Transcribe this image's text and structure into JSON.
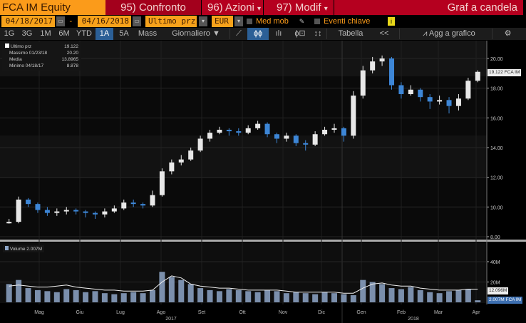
{
  "header": {
    "ticker": "FCA IM Equity",
    "compare": "95) Confronto",
    "actions": "96) Azioni",
    "modify": "97) Modif",
    "chart_type": "Graf a candela"
  },
  "controls": {
    "start_date": "04/18/2017",
    "end_date": "04/16/2018",
    "dash": "-",
    "field": "Ultimo prz",
    "currency": "EUR",
    "moving_avg": "Med mob",
    "key_events": "Eventi chiave",
    "info": "i"
  },
  "toolbar": {
    "periods": [
      "1G",
      "3G",
      "1M",
      "6M",
      "YTD",
      "1A",
      "5A",
      "Mass"
    ],
    "active_period": "1A",
    "frequency": "Giornaliero ▼",
    "table": "Tabella",
    "collapse": "<<",
    "add_to_chart": "Agg a grafico"
  },
  "legend": {
    "rows": [
      {
        "label": "Ultimo prz",
        "value": "19.122"
      },
      {
        "label": "Massimo 01/23/18",
        "value": "20.20"
      },
      {
        "label": "Media",
        "value": "13.8965"
      },
      {
        "label": "Minimo 04/18/17",
        "value": "8.878"
      }
    ]
  },
  "colors": {
    "up": "#e8e8e8",
    "down": "#3d86d6",
    "volume": "#8ea6c8",
    "ma": "#f0f0f0"
  },
  "chart_data": [
    {
      "type": "candlestick",
      "title": "FCA IM Equity",
      "ylim": [
        8,
        21
      ],
      "yticks": [
        "20.00",
        "18.00",
        "16.00",
        "14.00",
        "12.00",
        "10.00",
        "8.00"
      ],
      "last_label": "19.122 FCA IM",
      "open": [
        8.9,
        9.0,
        10.5,
        10.2,
        9.8,
        9.6,
        9.7,
        9.8,
        9.7,
        9.6,
        9.5,
        9.7,
        9.9,
        10.3,
        10.2,
        10.1,
        10.8,
        12.4,
        13.0,
        13.2,
        13.8,
        14.6,
        15.0,
        15.2,
        15.1,
        15.0,
        15.3,
        15.6,
        14.9,
        14.6,
        14.8,
        14.3,
        14.2,
        14.9,
        15.2,
        15.3,
        14.8,
        17.5,
        19.2,
        19.8,
        20.0,
        18.2,
        17.6,
        17.9,
        17.4,
        17.1,
        17.2,
        16.8,
        17.3,
        18.5
      ],
      "high": [
        9.2,
        10.7,
        10.6,
        10.3,
        10.0,
        9.9,
        10.0,
        9.9,
        9.8,
        9.7,
        9.9,
        10.1,
        10.5,
        10.5,
        10.3,
        11.1,
        12.6,
        13.2,
        13.5,
        14.0,
        14.8,
        15.2,
        15.4,
        15.3,
        15.3,
        15.5,
        15.8,
        15.7,
        15.0,
        15.0,
        14.9,
        14.5,
        15.1,
        15.4,
        15.6,
        15.4,
        17.8,
        19.5,
        20.1,
        20.2,
        20.1,
        18.4,
        18.2,
        18.0,
        17.6,
        17.5,
        17.4,
        17.6,
        18.7,
        19.2
      ],
      "low": [
        8.88,
        8.9,
        10.0,
        9.6,
        9.4,
        9.4,
        9.5,
        9.5,
        9.3,
        9.2,
        9.3,
        9.6,
        9.8,
        10.0,
        9.9,
        10.0,
        10.7,
        12.2,
        12.8,
        13.1,
        13.7,
        14.4,
        14.9,
        14.8,
        14.8,
        14.9,
        15.2,
        14.7,
        14.3,
        14.4,
        14.1,
        13.8,
        14.1,
        14.8,
        15.0,
        14.4,
        14.6,
        17.3,
        19.0,
        19.5,
        17.9,
        17.3,
        17.5,
        17.1,
        16.6,
        16.9,
        16.3,
        16.5,
        17.2,
        18.4
      ],
      "close": [
        9.0,
        10.5,
        10.2,
        9.8,
        9.6,
        9.7,
        9.8,
        9.7,
        9.6,
        9.5,
        9.7,
        9.9,
        10.3,
        10.2,
        10.1,
        10.8,
        12.4,
        13.0,
        13.2,
        13.8,
        14.6,
        15.0,
        15.2,
        15.1,
        15.0,
        15.3,
        15.6,
        14.9,
        14.6,
        14.8,
        14.3,
        14.2,
        14.9,
        15.2,
        15.3,
        14.8,
        17.5,
        19.2,
        19.8,
        20.0,
        18.2,
        17.6,
        17.9,
        17.4,
        17.1,
        17.2,
        16.8,
        17.3,
        18.5,
        19.1
      ]
    },
    {
      "type": "bar",
      "title": "Volume 2.007M",
      "ylim": [
        0,
        60
      ],
      "unit": "M",
      "yticks": [
        "40M",
        "20M"
      ],
      "ma_label": "12.096M",
      "last_label": "2.007M FCA IM",
      "values": [
        18,
        22,
        14,
        12,
        11,
        10,
        13,
        12,
        10,
        11,
        9,
        8,
        9,
        10,
        9,
        12,
        30,
        25,
        22,
        18,
        14,
        12,
        11,
        13,
        12,
        11,
        10,
        12,
        11,
        9,
        10,
        9,
        8,
        10,
        9,
        8,
        7,
        22,
        20,
        18,
        14,
        13,
        15,
        12,
        10,
        9,
        11,
        12,
        13,
        2
      ],
      "ma": [
        16,
        17,
        16,
        15,
        15,
        16,
        17,
        15,
        14,
        13,
        12,
        12,
        11,
        11,
        11,
        12,
        20,
        26,
        24,
        18,
        16,
        15,
        14,
        14,
        13,
        12,
        12,
        12,
        12,
        11,
        10,
        10,
        10,
        10,
        10,
        9,
        9,
        14,
        18,
        19,
        17,
        16,
        16,
        14,
        13,
        12,
        12,
        12,
        13,
        13
      ]
    }
  ],
  "xaxis": {
    "months": [
      "Mag",
      "Giu",
      "Lug",
      "Ago",
      "Set",
      "Ott",
      "Nov",
      "Dic",
      "Gen",
      "Feb",
      "Mar",
      "Apr"
    ],
    "years": [
      "2017",
      "2018"
    ]
  }
}
